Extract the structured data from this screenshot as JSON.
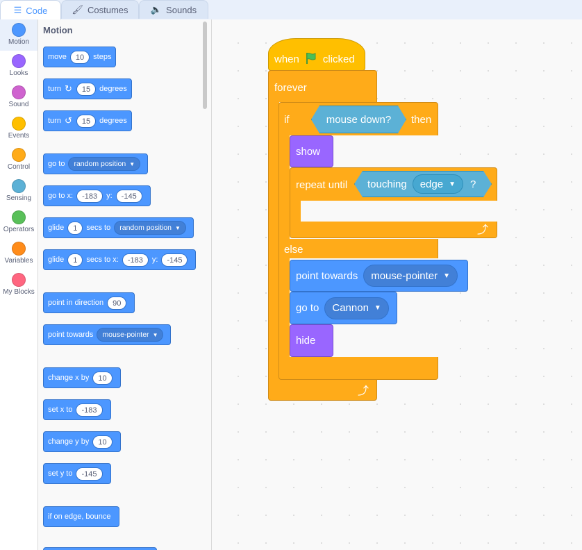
{
  "tabs": [
    {
      "label": "Code",
      "icon": "code-icon",
      "active": true
    },
    {
      "label": "Costumes",
      "icon": "brush-icon",
      "active": false
    },
    {
      "label": "Sounds",
      "icon": "speaker-icon",
      "active": false
    }
  ],
  "categories": [
    {
      "label": "Motion",
      "color": "#4c97ff"
    },
    {
      "label": "Looks",
      "color": "#9966ff"
    },
    {
      "label": "Sound",
      "color": "#cf63cf"
    },
    {
      "label": "Events",
      "color": "#ffbf00"
    },
    {
      "label": "Control",
      "color": "#ffab19"
    },
    {
      "label": "Sensing",
      "color": "#5cb1d6"
    },
    {
      "label": "Operators",
      "color": "#59c059"
    },
    {
      "label": "Variables",
      "color": "#ff8c1a"
    },
    {
      "label": "My Blocks",
      "color": "#ff6680"
    }
  ],
  "palette": {
    "title": "Motion",
    "move": {
      "label": "move",
      "value": "10",
      "suffix": "steps"
    },
    "turn_right": {
      "label": "turn",
      "value": "15",
      "suffix": "degrees"
    },
    "turn_left": {
      "label": "turn",
      "value": "15",
      "suffix": "degrees"
    },
    "goto": {
      "label": "go to",
      "option": "random position"
    },
    "goto_xy": {
      "label": "go to x:",
      "x": "-183",
      "ylabel": "y:",
      "y": "-145"
    },
    "glide_to": {
      "label": "glide",
      "secs": "1",
      "mid": "secs to",
      "option": "random position"
    },
    "glide_xy": {
      "label": "glide",
      "secs": "1",
      "mid": "secs to x:",
      "x": "-183",
      "ylabel": "y:",
      "y": "-145"
    },
    "point_dir": {
      "label": "point in direction",
      "value": "90"
    },
    "point_towards": {
      "label": "point towards",
      "option": "mouse-pointer"
    },
    "change_x": {
      "label": "change x by",
      "value": "10"
    },
    "set_x": {
      "label": "set x to",
      "value": "-183"
    },
    "change_y": {
      "label": "change y by",
      "value": "10"
    },
    "set_y": {
      "label": "set y to",
      "value": "-145"
    },
    "bounce": {
      "label": "if on edge, bounce"
    }
  },
  "script": {
    "hat": {
      "when": "when",
      "clicked": "clicked"
    },
    "forever": "forever",
    "if": "if",
    "condition": "mouse down?",
    "then": "then",
    "show": "show",
    "repeat_until": "repeat until",
    "touching": "touching",
    "touching_option": "edge",
    "question": "?",
    "else": "else",
    "point_towards": "point towards",
    "point_option": "mouse-pointer",
    "goto": "go to",
    "goto_option": "Cannon",
    "hide": "hide"
  }
}
